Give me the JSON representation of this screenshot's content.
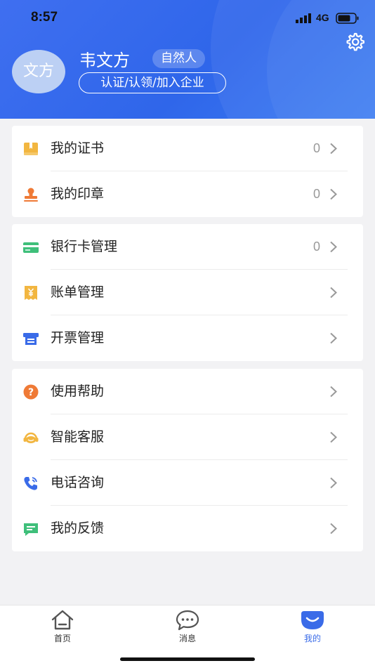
{
  "status_bar": {
    "time": "8:57",
    "network": "4G"
  },
  "profile": {
    "avatar_text": "文方",
    "name": "韦文方",
    "user_type": "自然人",
    "cert_button": "认证/认领/加入企业"
  },
  "groups": [
    {
      "items": [
        {
          "label": "我的证书",
          "count": "0",
          "icon": "certificate-icon",
          "color": "#f2b640"
        },
        {
          "label": "我的印章",
          "count": "0",
          "icon": "stamp-icon",
          "color": "#ef7a36"
        }
      ]
    },
    {
      "items": [
        {
          "label": "银行卡管理",
          "count": "0",
          "icon": "bank-card-icon",
          "color": "#3fbf7a"
        },
        {
          "label": "账单管理",
          "count": "",
          "icon": "bill-icon",
          "color": "#f2b640"
        },
        {
          "label": "开票管理",
          "count": "",
          "icon": "invoice-icon",
          "color": "#3a6be8"
        }
      ]
    },
    {
      "items": [
        {
          "label": "使用帮助",
          "count": "",
          "icon": "help-icon",
          "color": "#ef7a36"
        },
        {
          "label": "智能客服",
          "count": "",
          "icon": "customer-service-icon",
          "color": "#f2b640"
        },
        {
          "label": "电话咨询",
          "count": "",
          "icon": "phone-icon",
          "color": "#3a6be8"
        },
        {
          "label": "我的反馈",
          "count": "",
          "icon": "feedback-icon",
          "color": "#3fbf7a"
        }
      ]
    }
  ],
  "tabbar": {
    "home": "首页",
    "messages": "消息",
    "mine": "我的"
  },
  "colors": {
    "primary": "#3a6be8",
    "background": "#f2f2f4"
  }
}
